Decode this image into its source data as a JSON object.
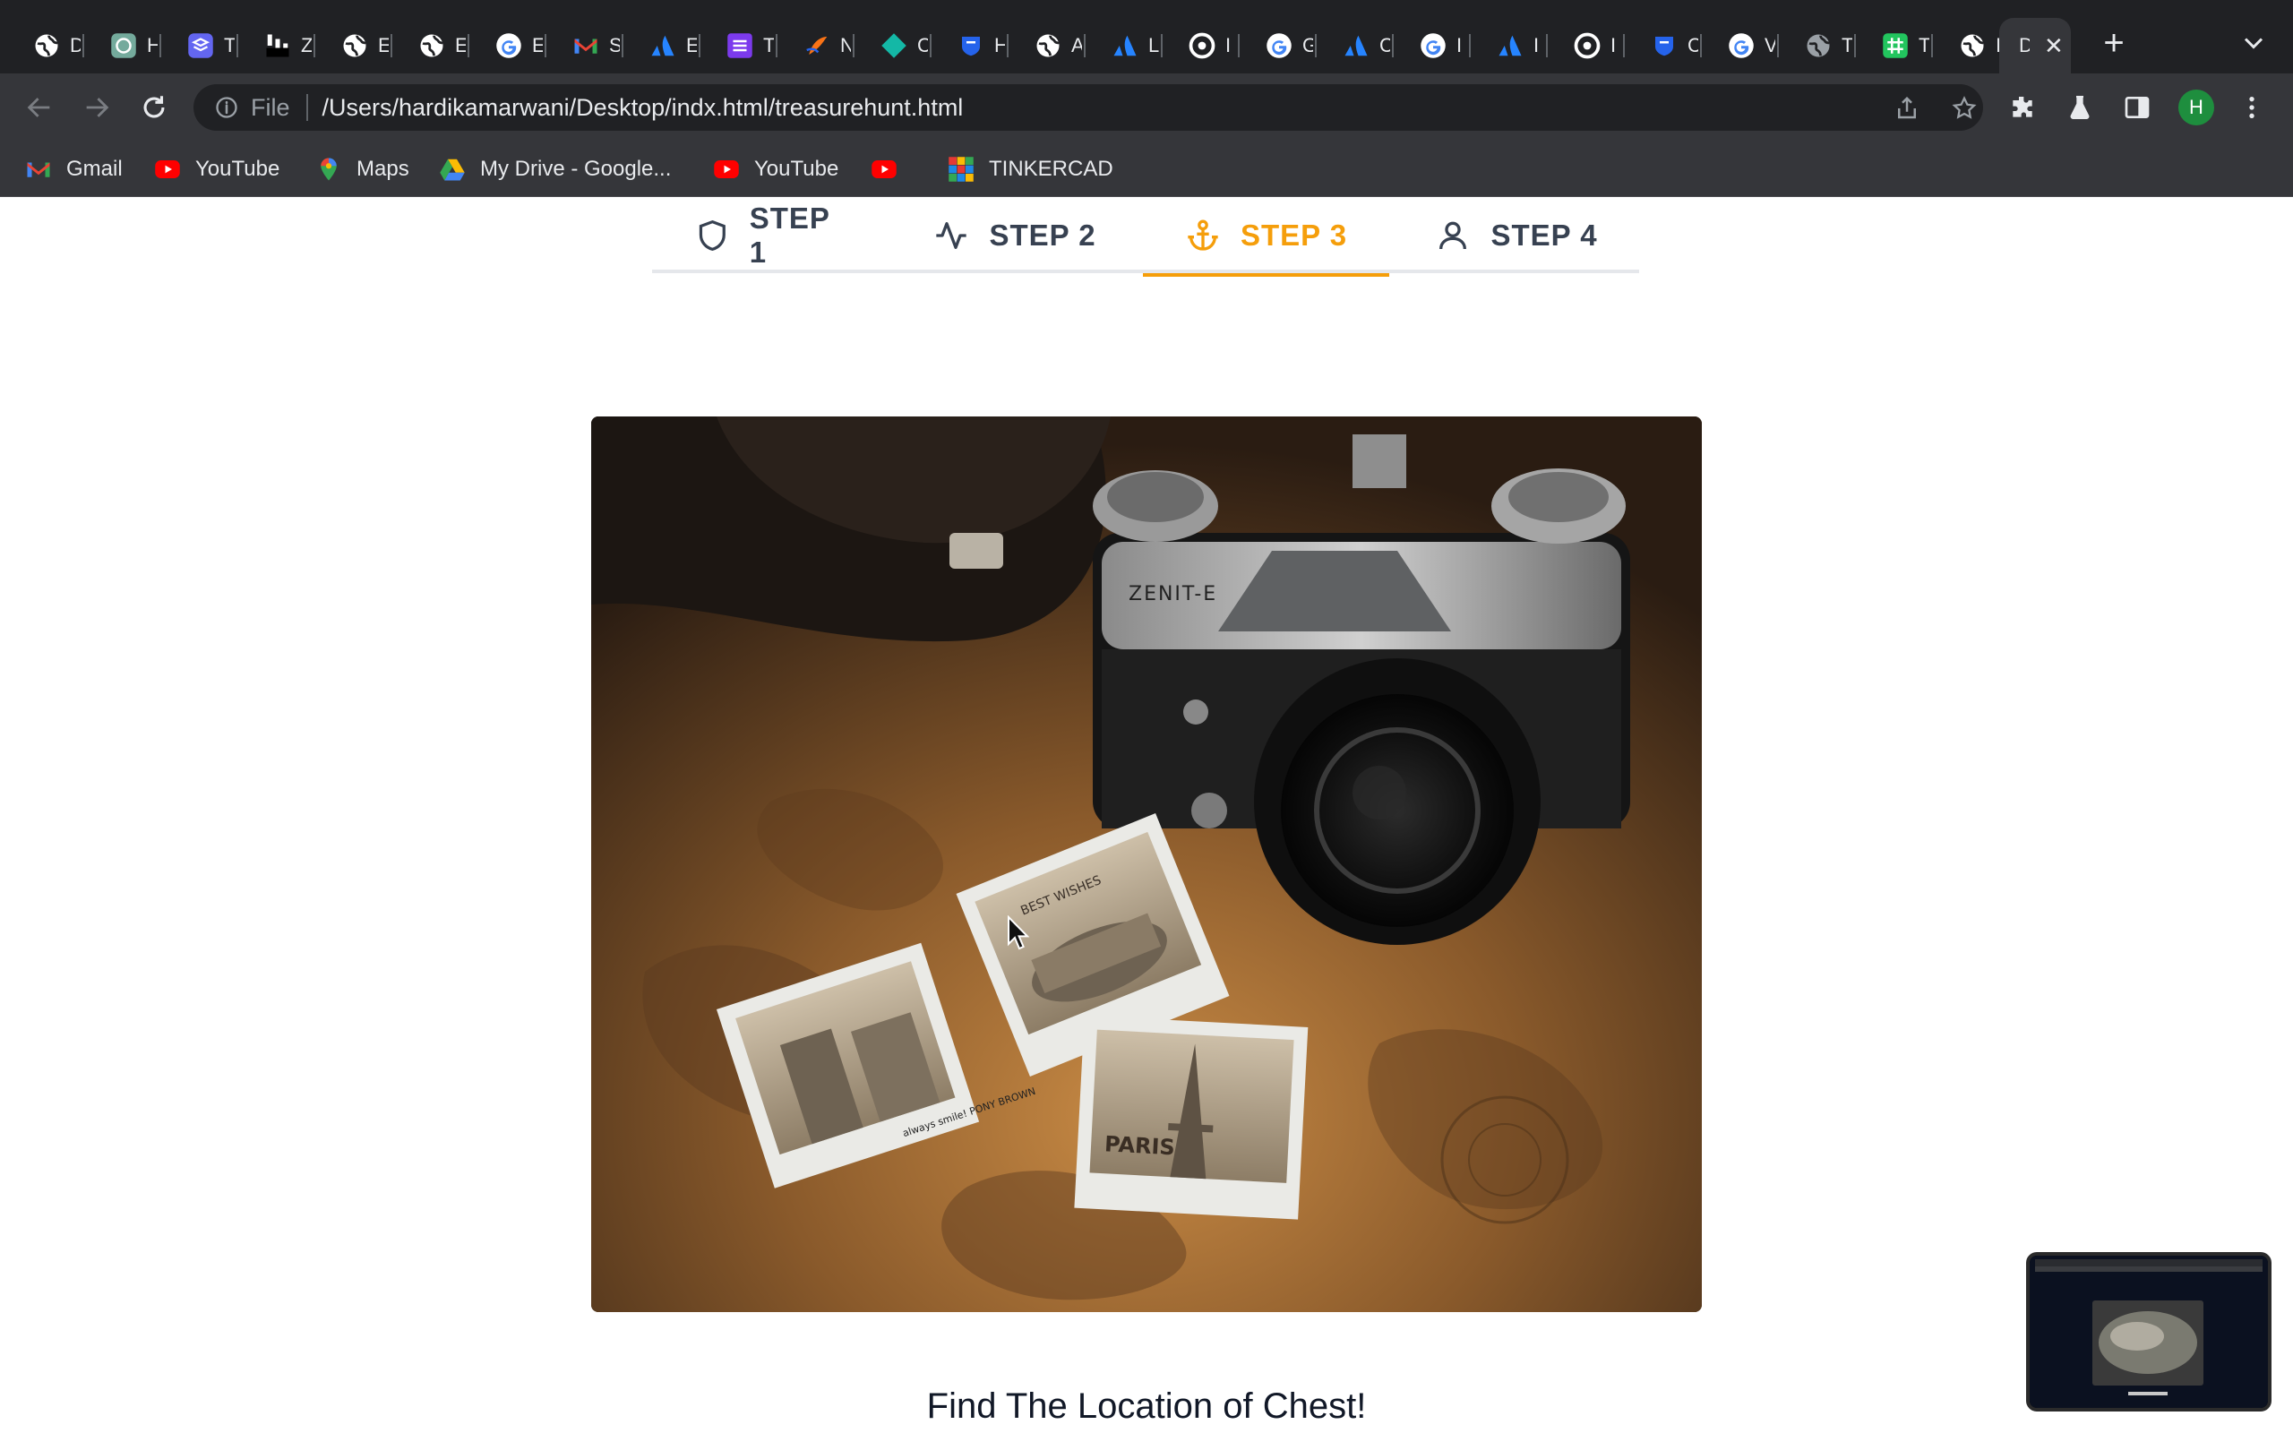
{
  "browser": {
    "tabs": [
      {
        "label": "D",
        "icon": "globe-icon",
        "color": "#ffffff"
      },
      {
        "label": "H",
        "icon": "chatgpt-icon",
        "color": "#74aa9c"
      },
      {
        "label": "T",
        "icon": "stack-icon",
        "color": "#6366f1"
      },
      {
        "label": "Z",
        "icon": "bars-icon",
        "color": "#ffffff"
      },
      {
        "label": "E",
        "icon": "globe-icon",
        "color": "#ffffff"
      },
      {
        "label": "E",
        "icon": "globe-icon",
        "color": "#ffffff"
      },
      {
        "label": "E",
        "icon": "google-icon",
        "color": "#4285f4"
      },
      {
        "label": "S",
        "icon": "gmail-icon",
        "color": "#ea4335"
      },
      {
        "label": "E",
        "icon": "atlassian-icon",
        "color": "#2684ff"
      },
      {
        "label": "T",
        "icon": "list-icon",
        "color": "#7c3aed"
      },
      {
        "label": "N",
        "icon": "bolt-icon",
        "color": "#f97316"
      },
      {
        "label": "C",
        "icon": "diamond-icon",
        "color": "#14b8a6"
      },
      {
        "label": "H",
        "icon": "shield-icon",
        "color": "#2563eb"
      },
      {
        "label": "A",
        "icon": "globe-icon",
        "color": "#ffffff"
      },
      {
        "label": "L",
        "icon": "atlassian-icon",
        "color": "#2684ff"
      },
      {
        "label": "I",
        "icon": "chrome-icon",
        "color": "#ffffff"
      },
      {
        "label": "G",
        "icon": "google-icon",
        "color": "#4285f4"
      },
      {
        "label": "C",
        "icon": "atlassian-icon",
        "color": "#2684ff"
      },
      {
        "label": "I",
        "icon": "google-icon",
        "color": "#4285f4"
      },
      {
        "label": "I",
        "icon": "atlassian-icon",
        "color": "#2684ff"
      },
      {
        "label": "I",
        "icon": "chrome-icon",
        "color": "#ffffff"
      },
      {
        "label": "C",
        "icon": "shield-icon",
        "color": "#2563eb"
      },
      {
        "label": "V",
        "icon": "google-icon",
        "color": "#4285f4"
      },
      {
        "label": "T",
        "icon": "globe-icon",
        "color": "#9aa0a6"
      },
      {
        "label": "T",
        "icon": "hash-icon",
        "color": "#22c55e"
      },
      {
        "label": "I",
        "icon": "globe-icon",
        "color": "#ffffff"
      }
    ],
    "active_tab": {
      "label": "D",
      "icon": "close-icon"
    },
    "new_tab_label": "+",
    "url_scheme": "File",
    "url": "/Users/hardikamarwani/Desktop/indx.html/treasurehunt.html",
    "profile_initial": "H",
    "bookmarks": [
      {
        "label": "Gmail",
        "icon": "gmail-icon",
        "color": "#ea4335"
      },
      {
        "label": "YouTube",
        "icon": "youtube-icon",
        "color": "#ff0000"
      },
      {
        "label": "Maps",
        "icon": "maps-pin-icon",
        "color": "#34a853"
      },
      {
        "label": "My Drive - Google...",
        "icon": "drive-icon",
        "color": "#fbbc04"
      },
      {
        "label": "YouTube",
        "icon": "youtube-icon",
        "color": "#ff0000"
      },
      {
        "label": "",
        "icon": "youtube-icon",
        "color": "#ff0000"
      },
      {
        "label": "TINKERCAD",
        "icon": "tinkercad-icon",
        "color": "#1477d1"
      }
    ]
  },
  "stepper": {
    "steps": [
      {
        "label": "STEP 1",
        "icon": "shield-icon"
      },
      {
        "label": "STEP 2",
        "icon": "activity-icon"
      },
      {
        "label": "STEP 3",
        "icon": "anchor-icon"
      },
      {
        "label": "STEP 4",
        "icon": "user-icon"
      }
    ],
    "active_index": 2,
    "active_color": "#f59e0b"
  },
  "hero": {
    "camera_brand": "ZENIT-E",
    "photo_labels": [
      "BEST WISHES",
      "PARIS",
      "always smile! PONY BROWN"
    ]
  },
  "page": {
    "heading": "Find The Location of Chest!"
  }
}
